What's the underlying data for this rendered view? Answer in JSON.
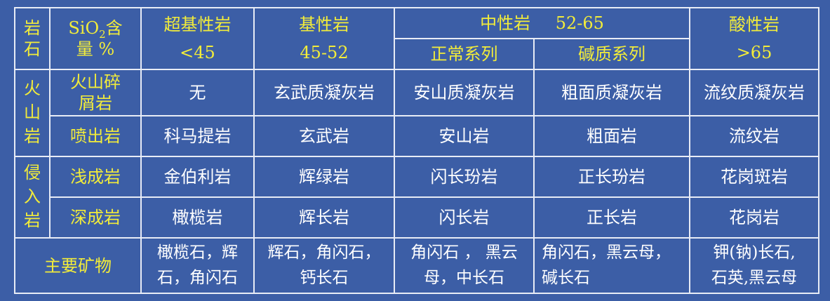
{
  "header": {
    "col0_line1": "岩",
    "col0_line2": "石",
    "sio2_prefix": "SiO",
    "sio2_sub": "2",
    "sio2_suffix": "含",
    "sio2_line2": "量 %",
    "ultrabasic_name": "超基性岩",
    "ultrabasic_range": "<45",
    "basic_name": "基性岩",
    "basic_range": "45-52",
    "intermediate_name": "中性岩",
    "intermediate_range": "52-65",
    "normal_series": "正常系列",
    "alkaline_series": "碱质系列",
    "acidic_name": "酸性岩",
    "acidic_range": ">65"
  },
  "groups": {
    "volcanic": [
      "火",
      "山",
      "岩"
    ],
    "intrusive": [
      "侵",
      "入",
      "岩"
    ]
  },
  "rows": [
    {
      "type_lines": [
        "火山碎",
        "屑岩"
      ],
      "cells": [
        "无",
        "玄武质凝灰岩",
        "安山质凝灰岩",
        "粗面质凝灰岩",
        "流纹质凝灰岩"
      ]
    },
    {
      "type_lines": [
        "喷出岩"
      ],
      "cells": [
        "科马提岩",
        "玄武岩",
        "安山岩",
        "粗面岩",
        "流纹岩"
      ]
    },
    {
      "type_lines": [
        "浅成岩"
      ],
      "cells": [
        "金伯利岩",
        "辉绿岩",
        "闪长玢岩",
        "正长玢岩",
        "花岗斑岩"
      ]
    },
    {
      "type_lines": [
        "深成岩"
      ],
      "cells": [
        "橄榄岩",
        "辉长岩",
        "闪长岩",
        "正长岩",
        "花岗岩"
      ]
    }
  ],
  "minerals": {
    "label": "主要矿物",
    "cells": [
      [
        "橄榄石，辉",
        "石，角闪石"
      ],
      [
        "辉石，角闪石，",
        "钙长石"
      ],
      [
        "角闪石 ， 黑云",
        "母，中长石"
      ],
      [
        "角闪石，黑云母，",
        "碱长石"
      ],
      [
        "钾(钠)长石,",
        "石英,黑云母"
      ]
    ]
  },
  "colors": {
    "background": "#3c5ea6",
    "border": "#e8ecf6",
    "header_text": "#f2ec3a",
    "body_text": "#ffffff"
  }
}
